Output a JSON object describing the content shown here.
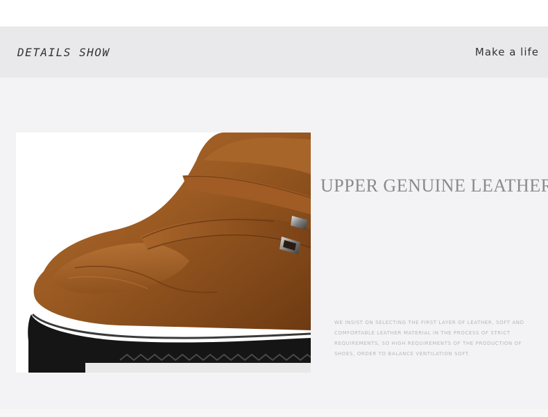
{
  "header": {
    "title": "DETAILS SHOW",
    "slogan": "Make a life"
  },
  "feature": {
    "heading": "UPPER GENUINE LEATHER",
    "description": "WE INSIST ON SELECTING THE FIRST LAYER OF LEATHER, SOFT AND COMFORTABLE LEATHER MATERIAL IN THE PROCESS OF STRICT REQUIREMENTS, SO HIGH REQUIREMENTS OF THE PRODUCTION OF SHOES, ORDER TO BALANCE VENTILATION SOFT."
  },
  "colors": {
    "header_band": "#e9e9eb",
    "page_background": "#f3f3f5",
    "leather_brown": "#9a5a22",
    "sole_black": "#151515"
  }
}
